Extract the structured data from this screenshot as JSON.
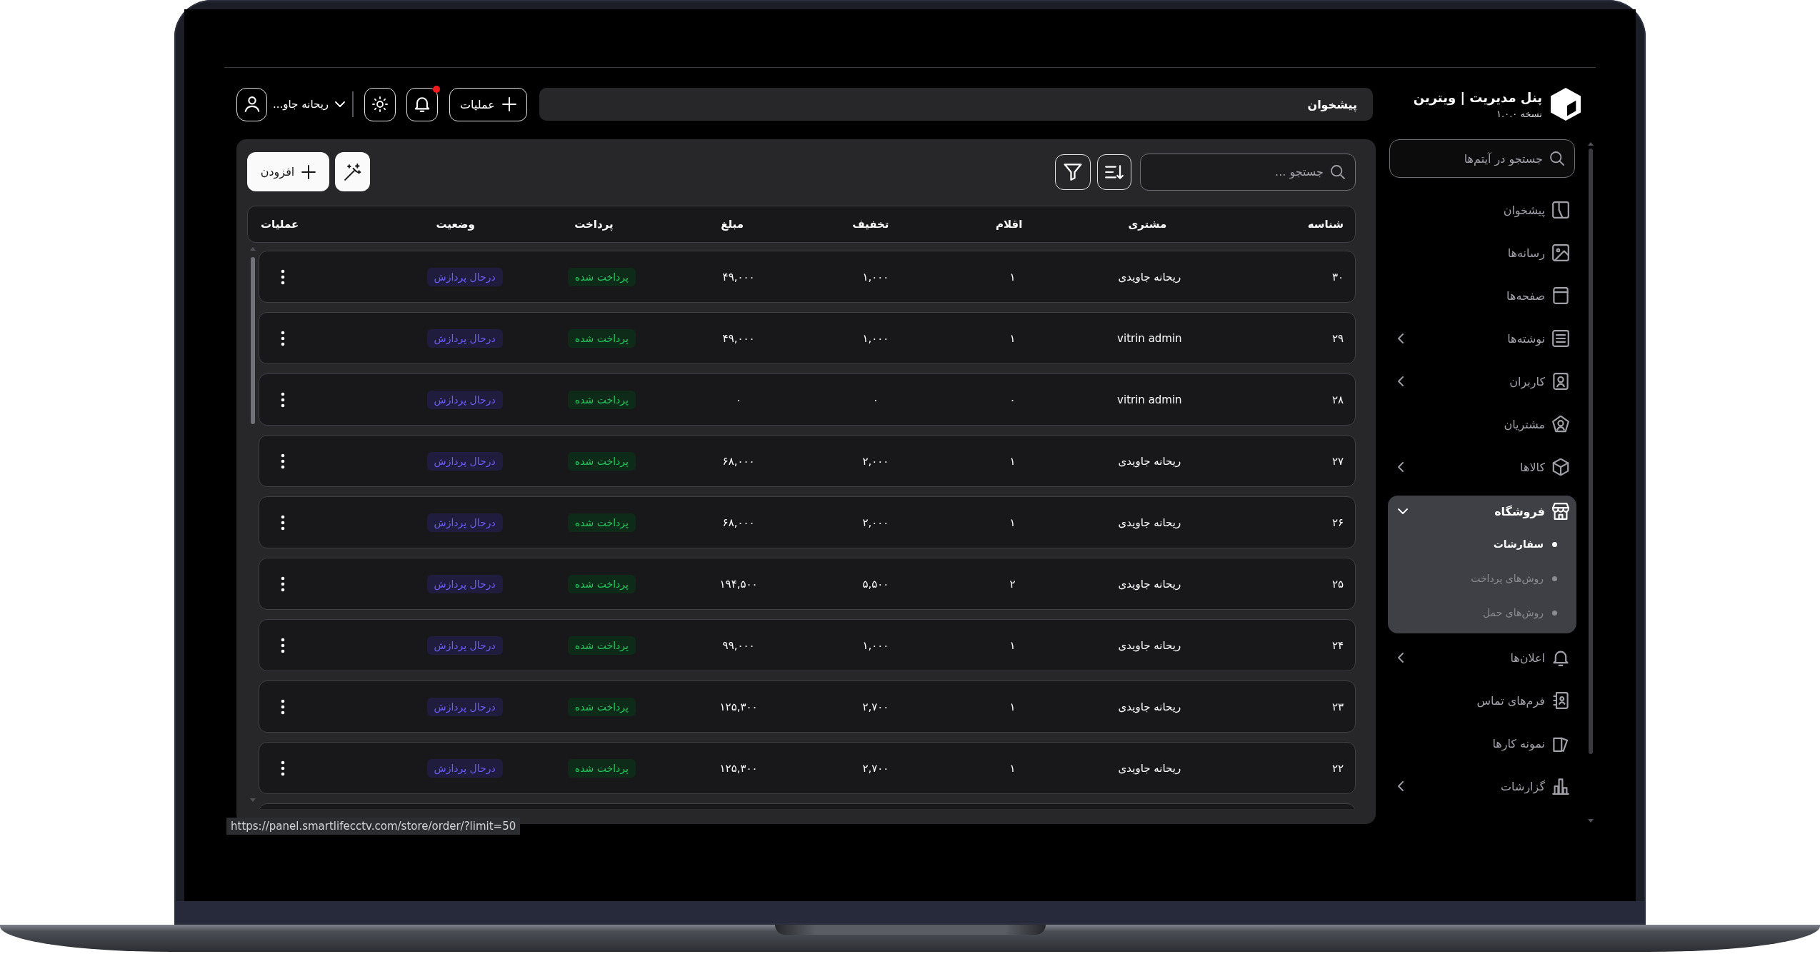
{
  "brand": {
    "title": "پنل مدیریت | ویترین",
    "version": "نسخه ۱.۰.۰"
  },
  "header": {
    "breadcrumb": "پیشخوان",
    "actions_button": "عملیات",
    "notifications": {
      "unread": true
    },
    "user": {
      "name": "ریحانه جاو..."
    }
  },
  "sidebar": {
    "search": {
      "placeholder": "جستجو در آیتم‌ها"
    },
    "items": [
      {
        "label": "پیشخوان",
        "expandable": false,
        "expanded": false,
        "selected": false
      },
      {
        "label": "رسانه‌ها",
        "expandable": false,
        "expanded": false,
        "selected": false
      },
      {
        "label": "صفحه‌ها",
        "expandable": false,
        "expanded": false,
        "selected": false
      },
      {
        "label": "نوشته‌ها",
        "expandable": true,
        "expanded": false,
        "selected": false
      },
      {
        "label": "کاربران",
        "expandable": true,
        "expanded": false,
        "selected": false
      },
      {
        "label": "مشتریان",
        "expandable": false,
        "expanded": false,
        "selected": false
      },
      {
        "label": "کالاها",
        "expandable": true,
        "expanded": false,
        "selected": false
      },
      {
        "label": "فروشگاه",
        "expandable": true,
        "expanded": true,
        "selected": false,
        "children": [
          {
            "label": "سفارشات",
            "selected": true
          },
          {
            "label": "روش‌های پرداخت",
            "selected": false
          },
          {
            "label": "روش‌های حمل",
            "selected": false
          }
        ]
      },
      {
        "label": "اعلان‌ها",
        "expandable": true,
        "expanded": false,
        "selected": false
      },
      {
        "label": "فرم‌های تماس",
        "expandable": false,
        "expanded": false,
        "selected": false
      },
      {
        "label": "نمونه کارها",
        "expandable": false,
        "expanded": false,
        "selected": false
      },
      {
        "label": "گزارشات",
        "expandable": true,
        "expanded": false,
        "selected": false
      }
    ]
  },
  "toolbar": {
    "search": {
      "placeholder": "جستجو ..."
    },
    "add_button": "افزودن"
  },
  "table": {
    "columns": [
      "شناسه",
      "مشتری",
      "اقلام",
      "تخفیف",
      "مبلغ",
      "پرداخت",
      "وضعیت",
      "عملیات"
    ],
    "rows": [
      {
        "id": "۳۰",
        "customer": "ریحانه جاویدی",
        "items": "۱",
        "discount": "۱,۰۰۰",
        "amount": "۴۹,۰۰۰",
        "payment": "پرداخت شده",
        "status": "درحال پردازش"
      },
      {
        "id": "۲۹",
        "customer": "vitrin admin",
        "items": "۱",
        "discount": "۱,۰۰۰",
        "amount": "۴۹,۰۰۰",
        "payment": "پرداخت شده",
        "status": "درحال پردازش"
      },
      {
        "id": "۲۸",
        "customer": "vitrin admin",
        "items": "۰",
        "discount": "۰",
        "amount": "۰",
        "payment": "پرداخت شده",
        "status": "درحال پردازش"
      },
      {
        "id": "۲۷",
        "customer": "ریحانه جاویدی",
        "items": "۱",
        "discount": "۲,۰۰۰",
        "amount": "۶۸,۰۰۰",
        "payment": "پرداخت شده",
        "status": "درحال پردازش"
      },
      {
        "id": "۲۶",
        "customer": "ریحانه جاویدی",
        "items": "۱",
        "discount": "۲,۰۰۰",
        "amount": "۶۸,۰۰۰",
        "payment": "پرداخت شده",
        "status": "درحال پردازش"
      },
      {
        "id": "۲۵",
        "customer": "ریحانه جاویدی",
        "items": "۲",
        "discount": "۵,۵۰۰",
        "amount": "۱۹۴,۵۰۰",
        "payment": "پرداخت شده",
        "status": "درحال پردازش"
      },
      {
        "id": "۲۴",
        "customer": "ریحانه جاویدی",
        "items": "۱",
        "discount": "۱,۰۰۰",
        "amount": "۹۹,۰۰۰",
        "payment": "پرداخت شده",
        "status": "درحال پردازش"
      },
      {
        "id": "۲۳",
        "customer": "ریحانه جاویدی",
        "items": "۱",
        "discount": "۲,۷۰۰",
        "amount": "۱۲۵,۳۰۰",
        "payment": "پرداخت شده",
        "status": "درحال پردازش"
      },
      {
        "id": "۲۲",
        "customer": "ریحانه جاویدی",
        "items": "۱",
        "discount": "۲,۷۰۰",
        "amount": "۱۲۵,۳۰۰",
        "payment": "پرداخت شده",
        "status": "درحال پردازش"
      }
    ]
  },
  "status_url": "https://panel.smartlifecctv.com/store/order/?limit=50"
}
